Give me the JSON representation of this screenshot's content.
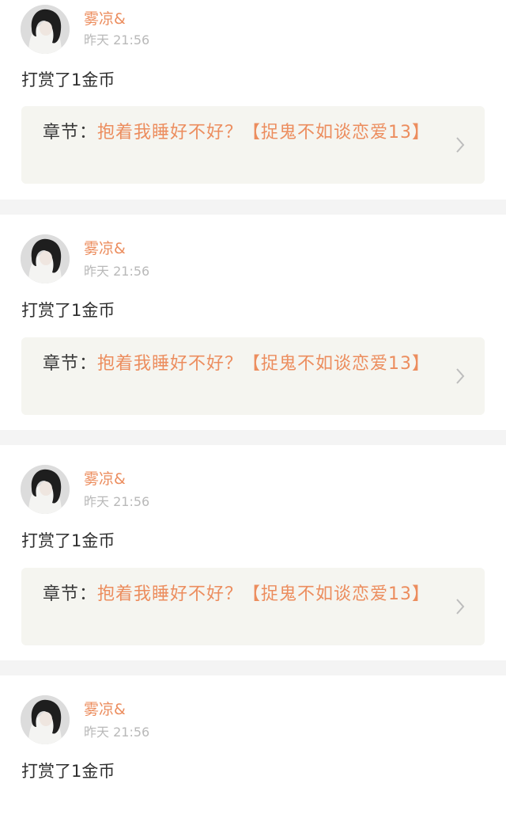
{
  "colors": {
    "username": "#ec8d5e",
    "chapter_title": "#ec8d5e",
    "timestamp": "#b9b9b9",
    "body_text": "#2f2f2f",
    "chapter_box_bg": "#f5f5f0",
    "divider": "#f4f4f4",
    "top_accent": "#e87aa8"
  },
  "feed": {
    "items": [
      {
        "avatar_icon": "user-avatar",
        "username": "雾凉&",
        "time": "昨天 21:56",
        "action": "打赏了1金币",
        "chapter_label": "章节：",
        "chapter_title": "抱着我睡好不好？【捉鬼不如谈恋爱13】",
        "chevron_icon": "chevron-right-icon"
      },
      {
        "avatar_icon": "user-avatar",
        "username": "雾凉&",
        "time": "昨天 21:56",
        "action": "打赏了1金币",
        "chapter_label": "章节：",
        "chapter_title": "抱着我睡好不好？【捉鬼不如谈恋爱13】",
        "chevron_icon": "chevron-right-icon"
      },
      {
        "avatar_icon": "user-avatar",
        "username": "雾凉&",
        "time": "昨天 21:56",
        "action": "打赏了1金币",
        "chapter_label": "章节：",
        "chapter_title": "抱着我睡好不好？【捉鬼不如谈恋爱13】",
        "chevron_icon": "chevron-right-icon"
      },
      {
        "avatar_icon": "user-avatar",
        "username": "雾凉&",
        "time": "昨天 21:56",
        "action": "打赏了1金币"
      }
    ]
  }
}
